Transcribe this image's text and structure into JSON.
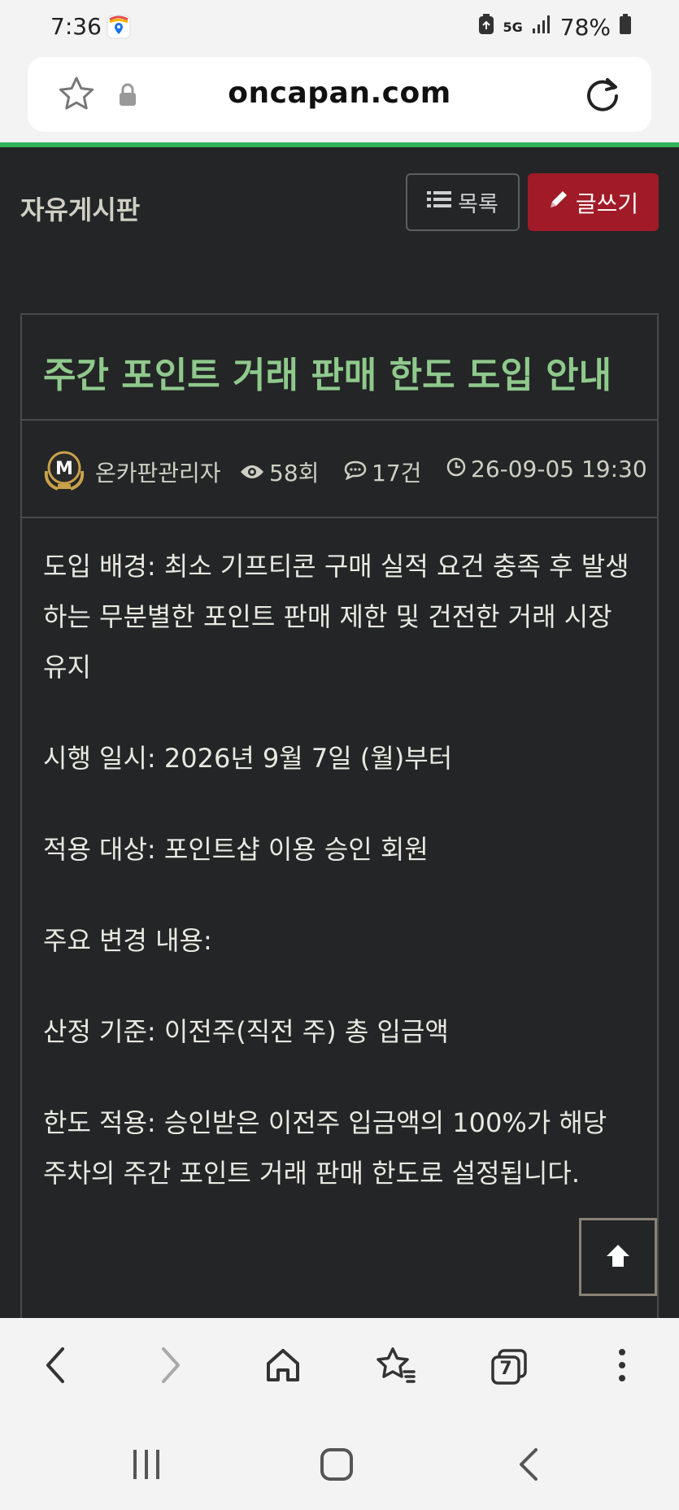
{
  "status_bar": {
    "time": "7:36",
    "network": "5G",
    "battery": "78%"
  },
  "browser": {
    "url": "oncapan.com",
    "tab_count": "7"
  },
  "board": {
    "title": "자유게시판",
    "list_button": "목록",
    "write_button": "글쓰기"
  },
  "post": {
    "title": "주간 포인트 거래 판매 한도 도입 안내",
    "avatar_letter": "M",
    "author": "온카판관리자",
    "views": "58회",
    "comments": "17건",
    "date": "26-09-05 19:30",
    "paragraphs": [
      "도입 배경: 최소 기프티콘 구매 실적 요건 충족 후 발생하는 무분별한 포인트 판매 제한 및 건전한 거래 시장 유지",
      "시행 일시: 2026년 9월 7일 (월)부터",
      "적용 대상: 포인트샵 이용 승인 회원",
      "주요 변경 내용:",
      "산정 기준: 이전주(직전 주) 총 입금액",
      "한도 적용: 승인받은 이전주 입금액의 100%가 해당 주차의 주간 포인트 거래 판매 한도로 설정됩니다."
    ]
  },
  "colors": {
    "accent_green": "#2fb35a",
    "title_green": "#8fc98c",
    "write_red": "#a01b27",
    "page_bg": "#232526"
  }
}
